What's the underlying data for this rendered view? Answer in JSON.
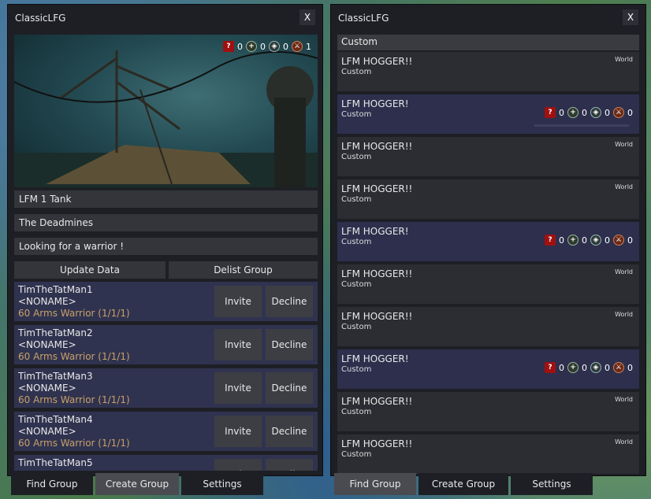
{
  "left": {
    "title": "ClassicLFG",
    "close": "X",
    "banner_roles": {
      "q": "?",
      "heal": "+",
      "tank": "◈",
      "dps": "⚔",
      "q_count": "0",
      "heal_count": "0",
      "tank_count": "0",
      "dps_count": "1"
    },
    "fields": {
      "title": "LFM 1 Tank",
      "dungeon": "The Deadmines",
      "description": "Looking for a warrior !"
    },
    "buttons": {
      "update": "Update Data",
      "delist": "Delist Group"
    },
    "applicants": [
      {
        "name": "TimTheTatMan1",
        "guild": "<NONAME>",
        "spec": "60 Arms Warrior (1/1/1)"
      },
      {
        "name": "TimTheTatMan2",
        "guild": "<NONAME>",
        "spec": "60 Arms Warrior (1/1/1)"
      },
      {
        "name": "TimTheTatMan3",
        "guild": "<NONAME>",
        "spec": "60 Arms Warrior (1/1/1)"
      },
      {
        "name": "TimTheTatMan4",
        "guild": "<NONAME>",
        "spec": "60 Arms Warrior (1/1/1)"
      },
      {
        "name": "TimTheTatMan5",
        "guild": "",
        "spec": ""
      }
    ],
    "invite_label": "Invite",
    "decline_label": "Decline",
    "tabs": [
      "Find Group",
      "Create Group",
      "Settings"
    ],
    "active_tab": "Create Group"
  },
  "right": {
    "title": "ClassicLFG",
    "close": "X",
    "header": "Custom",
    "groups": [
      {
        "title": "LFM HOGGER!!",
        "sub": "Custom",
        "tag": "World",
        "selected": false
      },
      {
        "title": "LFM HOGGER!",
        "sub": "Custom",
        "tag": "",
        "selected": true,
        "roles": [
          "0",
          "0",
          "0",
          "0"
        ]
      },
      {
        "title": "LFM HOGGER!!",
        "sub": "Custom",
        "tag": "World",
        "selected": false
      },
      {
        "title": "LFM HOGGER!!",
        "sub": "Custom",
        "tag": "World",
        "selected": false
      },
      {
        "title": "LFM HOGGER!",
        "sub": "Custom",
        "tag": "",
        "selected": true,
        "roles": [
          "0",
          "0",
          "0",
          "0"
        ]
      },
      {
        "title": "LFM HOGGER!!",
        "sub": "Custom",
        "tag": "World",
        "selected": false
      },
      {
        "title": "LFM HOGGER!!",
        "sub": "Custom",
        "tag": "World",
        "selected": false
      },
      {
        "title": "LFM HOGGER!",
        "sub": "Custom",
        "tag": "",
        "selected": true,
        "roles": [
          "0",
          "0",
          "0",
          "0"
        ]
      },
      {
        "title": "LFM HOGGER!!",
        "sub": "Custom",
        "tag": "World",
        "selected": false
      },
      {
        "title": "LFM HOGGER!!",
        "sub": "Custom",
        "tag": "World",
        "selected": false
      }
    ],
    "tabs": [
      "Find Group",
      "Create Group",
      "Settings"
    ],
    "active_tab": "Find Group"
  },
  "colors": {
    "panel": "#1e1f25",
    "selected_row": "#2d2f4d",
    "spec_text": "#c8a06a"
  }
}
